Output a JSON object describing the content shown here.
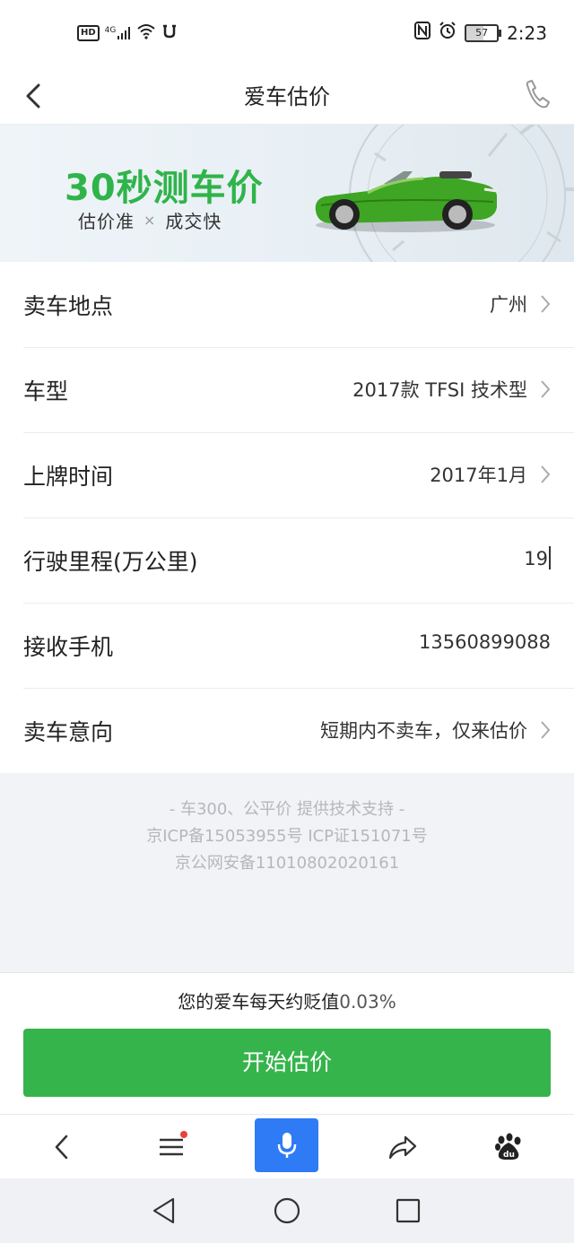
{
  "status_bar": {
    "left_badge": "HD",
    "network_label": "4G",
    "battery_level": "57",
    "time": "2:23",
    "icons": [
      "hd-icon",
      "signal-icon",
      "wifi-icon",
      "notification-icon",
      "nfc-icon",
      "alarm-icon",
      "battery-icon"
    ]
  },
  "header": {
    "title": "爱车估价",
    "back_icon": "chevron-left-icon",
    "phone_icon": "phone-icon"
  },
  "banner": {
    "headline": "30秒测车价",
    "tag_left": "估价准",
    "tag_sep": "×",
    "tag_right": "成交快"
  },
  "form": {
    "rows": [
      {
        "label": "卖车地点",
        "value": "广州"
      },
      {
        "label": "车型",
        "value": "2017款 TFSI 技术型"
      },
      {
        "label": "上牌时间",
        "value": "2017年1月"
      },
      {
        "label": "行驶里程(万公里)",
        "value": "19"
      },
      {
        "label": "接收手机",
        "value": "13560899088"
      },
      {
        "label": "卖车意向",
        "value": "短期内不卖车，仅来估价"
      }
    ]
  },
  "footer": {
    "line1": "- 车300、公平价 提供技术支持 -",
    "line2": "京ICP备15053955号 ICP证151071号",
    "line3": "京公网安备11010802020161"
  },
  "cta": {
    "depreciation_text": "您的爱车每天约贬值",
    "depreciation_rate": "0.03%",
    "button_label": "开始估价"
  },
  "browser_bar": {
    "items": [
      "back-icon",
      "menu-icon",
      "microphone-icon",
      "share-icon",
      "baidu-icon"
    ],
    "accent_color": "#2f7bf5"
  },
  "system_nav": {
    "items": [
      "nav-back-icon",
      "nav-home-icon",
      "nav-recents-icon"
    ]
  },
  "colors": {
    "brand_green": "#35b44b",
    "headline_green": "#2fb44a"
  }
}
